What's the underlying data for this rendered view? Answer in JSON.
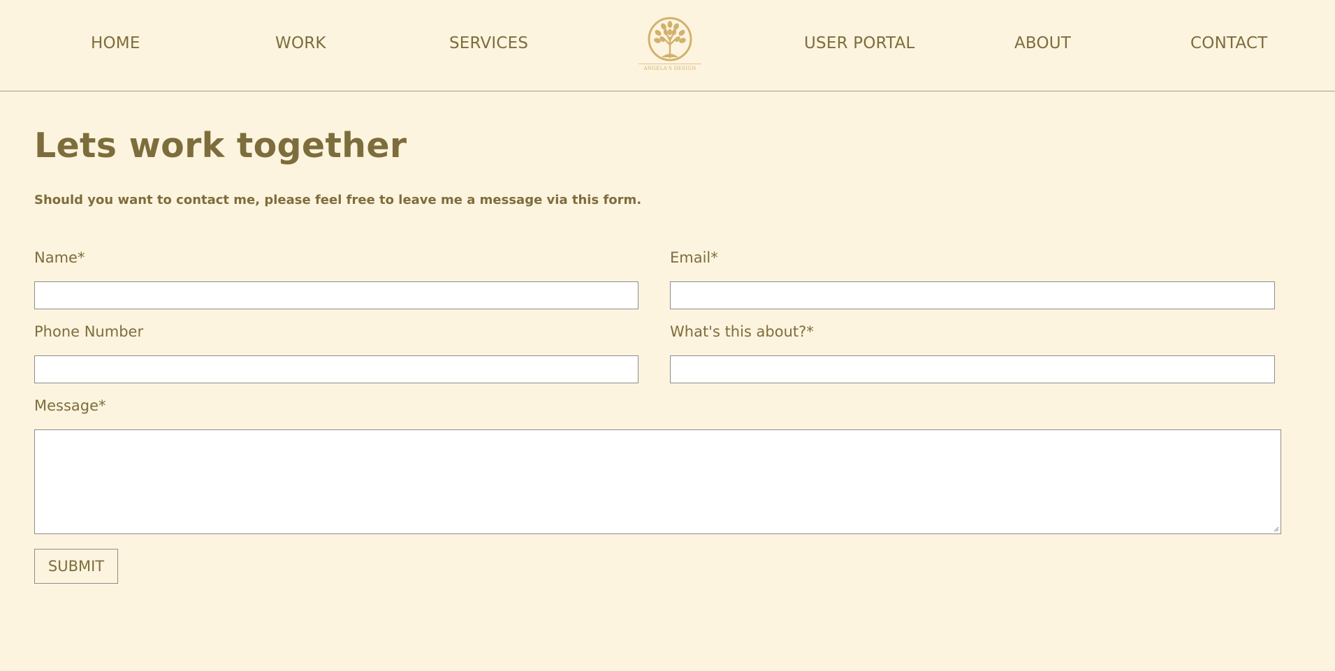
{
  "nav": {
    "items": [
      {
        "label": "HOME"
      },
      {
        "label": "WORK"
      },
      {
        "label": "SERVICES"
      },
      {
        "label": "USER PORTAL"
      },
      {
        "label": "ABOUT"
      },
      {
        "label": "CONTACT"
      }
    ],
    "logo": {
      "text": "ANGELA'S DESIGN",
      "icon": "tree-icon",
      "color": "#d1b16d"
    }
  },
  "main": {
    "title": "Lets work together",
    "intro": "Should you want to contact me, please feel free to leave me a message via this form."
  },
  "form": {
    "name_label": "Name*",
    "name_value": "",
    "email_label": "Email*",
    "email_value": "",
    "phone_label": "Phone Number",
    "phone_value": "",
    "about_label": "What's this about?*",
    "about_value": "",
    "message_label": "Message*",
    "message_value": "",
    "submit_label": "SUBMIT"
  },
  "colors": {
    "background": "#fdf4df",
    "text": "#7d6d3c",
    "logo": "#d1b16d",
    "field": "#ffffff",
    "border": "#8d8d8d"
  }
}
